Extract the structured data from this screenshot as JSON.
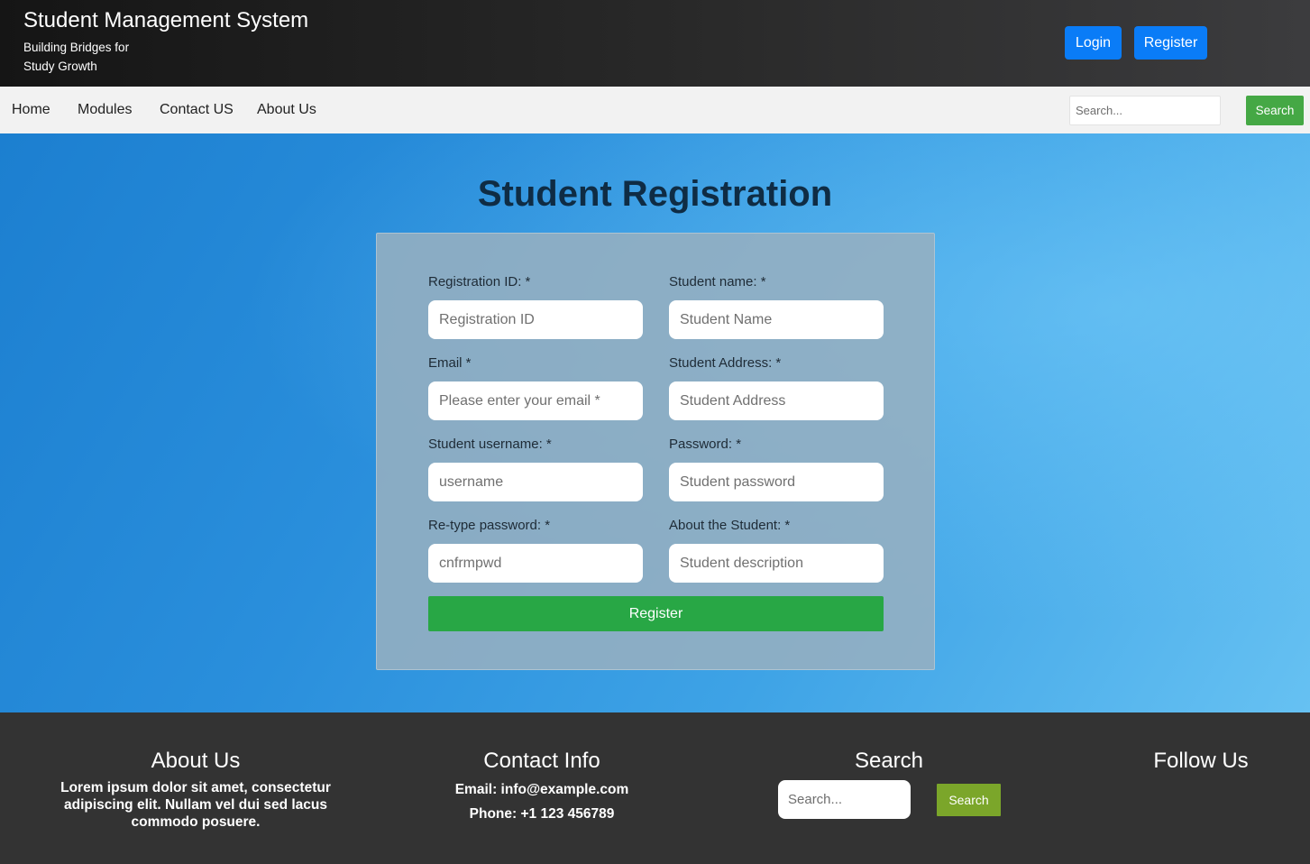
{
  "header": {
    "title": "Student Management System",
    "tagline": "Building Bridges for Study Growth",
    "login_label": "Login",
    "register_label": "Register"
  },
  "nav": {
    "items": [
      {
        "label": "Home"
      },
      {
        "label": "Modules"
      },
      {
        "label": "Contact US"
      },
      {
        "label": "About Us"
      }
    ],
    "search_placeholder": "Search...",
    "search_button": "Search"
  },
  "form": {
    "title": "Student Registration",
    "fields": [
      {
        "label": "Registration ID: *",
        "placeholder": "Registration ID"
      },
      {
        "label": "Student name: *",
        "placeholder": "Student Name"
      },
      {
        "label": "Email *",
        "placeholder": "Please enter your email *"
      },
      {
        "label": "Student Address: *",
        "placeholder": "Student Address"
      },
      {
        "label": "Student username: *",
        "placeholder": "username"
      },
      {
        "label": "Password: *",
        "placeholder": "Student password"
      },
      {
        "label": "Re-type password: *",
        "placeholder": "cnfrmpwd"
      },
      {
        "label": "About the Student: *",
        "placeholder": "Student description"
      }
    ],
    "submit_label": "Register"
  },
  "footer": {
    "about": {
      "heading": "About Us",
      "text": "Lorem ipsum dolor sit amet, consectetur adipiscing elit. Nullam vel dui sed lacus commodo posuere."
    },
    "contact": {
      "heading": "Contact Info",
      "email": "Email: info@example.com",
      "phone": "Phone: +1 123 456789"
    },
    "search": {
      "heading": "Search",
      "placeholder": "Search...",
      "button": "Search"
    },
    "follow": {
      "heading": "Follow Us"
    }
  },
  "colors": {
    "primary_button": "#0a7cf7",
    "success_button": "#28a745",
    "nav_search_button": "#45a845",
    "footer_search_button": "#7ba62a",
    "footer_background": "#333333"
  }
}
